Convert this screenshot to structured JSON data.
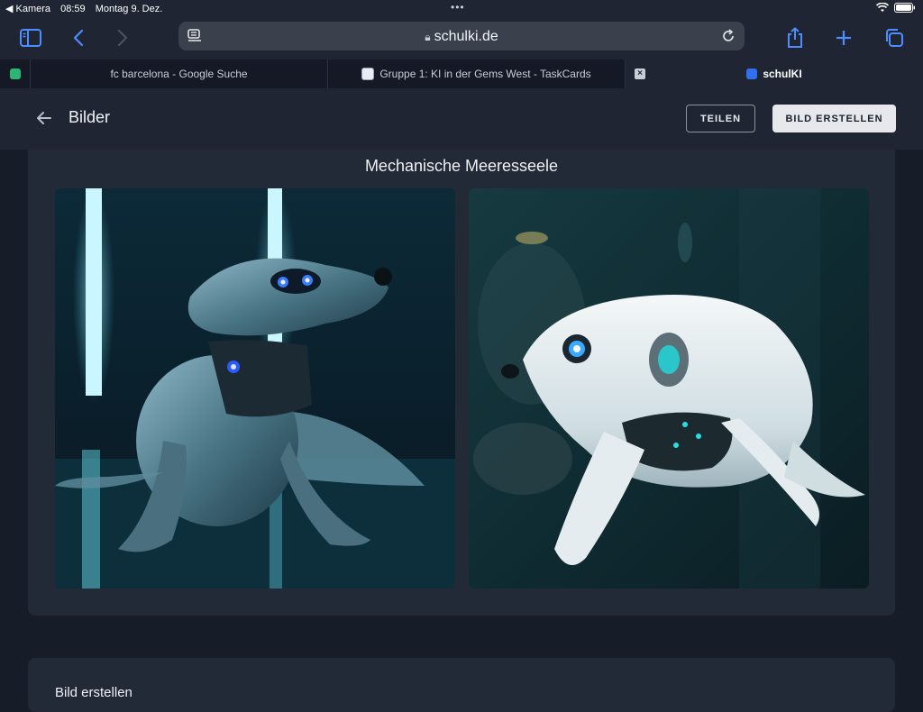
{
  "statusbar": {
    "back_app": "◀ Kamera",
    "time": "08:59",
    "date": "Montag 9. Dez."
  },
  "browser": {
    "url": "schulki.de",
    "tabs": [
      {
        "label": "fc barcelona - Google Suche",
        "active": false
      },
      {
        "label": "Gruppe 1: KI in der Gems West - TaskCards",
        "active": false
      },
      {
        "label": "schulKI",
        "active": true
      }
    ]
  },
  "header": {
    "title": "Bilder",
    "share_label": "TEILEN",
    "create_label": "BILD ERSTELLEN"
  },
  "gallery": {
    "title": "Mechanische Meeresseele",
    "images": [
      {
        "name": "robot-seal-dark-lab"
      },
      {
        "name": "robot-seal-white-aquarium"
      }
    ]
  },
  "next_section": {
    "label": "Bild erstellen"
  },
  "colors": {
    "accent": "#2f6ff0",
    "background": "#161c28",
    "card": "#232a37"
  }
}
